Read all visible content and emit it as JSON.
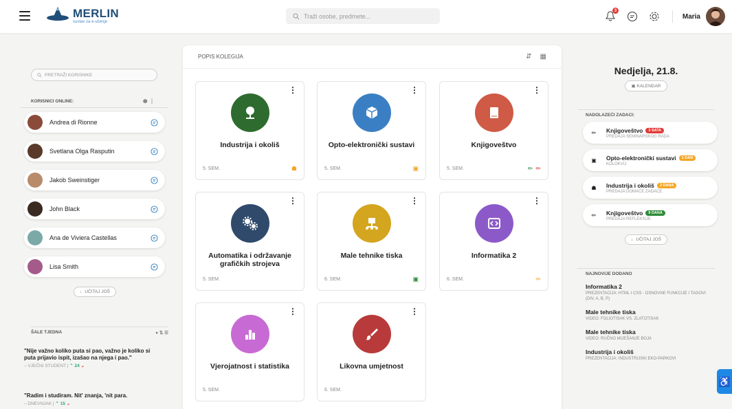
{
  "header": {
    "logo_title": "MERLIN",
    "logo_subtitle": "sustav za e-učenje",
    "search_placeholder": "Traži osobe, predmete...",
    "notifications_count": "3",
    "user_name": "Maria"
  },
  "left": {
    "search_placeholder": "PRETRAŽI KORISNIKE",
    "online_title": "KORISNICI ONLINE:",
    "users": [
      {
        "name": "Andrea di Rionne",
        "color": "#8a4b3a"
      },
      {
        "name": "Svetlana Olga Rasputin",
        "color": "#5a3a2a"
      },
      {
        "name": "Jakob Sweinstiger",
        "color": "#b88b6a"
      },
      {
        "name": "John Black",
        "color": "#3a2a22"
      },
      {
        "name": "Ana de Viviera Castellas",
        "color": "#7aa9a8"
      },
      {
        "name": "Lisa Smith",
        "color": "#a45a8a"
      }
    ],
    "load_more": "UČITAJ JOŠ",
    "quotes_title": "ŠALE TJEDNA",
    "quotes": [
      {
        "text": "\"Nije važno koliko puta si pao, važno je koliko si puta prijavio ispit, izašao na njega i pao.\"",
        "author": "– VJEČNI STUDENT",
        "up": "24"
      },
      {
        "text": "\"Radim i studiram. Nit' znanja, 'nit para.",
        "author": "– DNEVNJAK",
        "up": "15"
      }
    ]
  },
  "main": {
    "title": "POPIS KOLEGIJA",
    "courses": [
      {
        "title": "Industrija i okoliš",
        "sem": "5. SEM.",
        "color": "#2e6b2e",
        "icon": "tree-icon"
      },
      {
        "title": "Opto-elektronički sustavi",
        "sem": "5. SEM.",
        "color": "#3a7fc4",
        "icon": "cube-icon"
      },
      {
        "title": "Knjigoveštvo",
        "sem": "5. SEM.",
        "color": "#cf5a45",
        "icon": "book-icon"
      },
      {
        "title": "Automatika i održavanje grafičkih strojeva",
        "sem": "5. SEM.",
        "color": "#2f4a6b",
        "icon": "gears-icon"
      },
      {
        "title": "Male tehnike tiska",
        "sem": "6. SEM.",
        "color": "#d4a51e",
        "icon": "network-icon"
      },
      {
        "title": "Informatika 2",
        "sem": "6. SEM.",
        "color": "#8c5ac8",
        "icon": "code-icon"
      },
      {
        "title": "Vjerojatnost i statistika",
        "sem": "5. SEM.",
        "color": "#c86ad4",
        "icon": "barchart-icon"
      },
      {
        "title": "Likovna umjetnost",
        "sem": "6. SEM.",
        "color": "#b83a3a",
        "icon": "brush-icon"
      }
    ]
  },
  "right": {
    "date": "Nedjelja, 21.8.",
    "calendar_label": "KALENDAR",
    "tasks_title": "NADOLAZEĆI ZADACI:",
    "tasks": [
      {
        "title": "Knjigoveštvo",
        "tag": "3 SATA",
        "tag_color": "#e53935",
        "sub": "PREDAJA SEMINARSKOG RADA"
      },
      {
        "title": "Opto-elektronički sustavi",
        "tag": "1 DAN",
        "tag_color": "#f5a623",
        "sub": "KOLOKVIJ"
      },
      {
        "title": "Industrija i okoliš",
        "tag": "3 DANA",
        "tag_color": "#f5a623",
        "sub": "PREDAJA DOMAĆE ZADAĆE"
      },
      {
        "title": "Knjigoveštvo",
        "tag": "9 DANA",
        "tag_color": "#2e8b3a",
        "sub": "PREDAJA REFLEKSIJE"
      }
    ],
    "load_more": "UČITAJ JOŠ",
    "news_title": "NAJNOVIJE DODANO",
    "news": [
      {
        "title": "Informatika 2",
        "sub": "PREZENTACIJA: HTML I CSS - OSNOVNE FUNKCIJE I TAGOVI (DIV, A, B, P)"
      },
      {
        "title": "Male tehnike tiska",
        "sub": "VIDEO: FOLIOTISAK VS. ZLATOTISAK"
      },
      {
        "title": "Male tehnike tiska",
        "sub": "VIDEO: RUČNO MIJEŠANJE BOJA"
      },
      {
        "title": "Industrija i okoliš",
        "sub": "PREZENTACIJA: INDUSTRIJSKI EKO-PARKOVI"
      }
    ]
  }
}
